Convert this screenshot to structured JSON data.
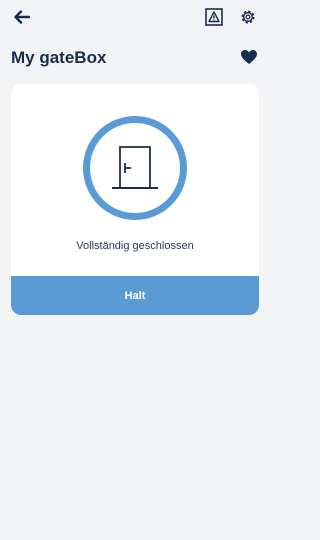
{
  "header": {
    "back_icon": "arrow-left-icon",
    "actions": [
      {
        "icon": "warning-triangle-icon"
      },
      {
        "icon": "gear-icon"
      }
    ]
  },
  "device": {
    "name": "My gateBox",
    "favorite_icon": "heart-icon",
    "favorite": true
  },
  "card": {
    "state_icon": "door-closed-icon",
    "status_text": "Vollständig geschlossen",
    "action_label": "Halt"
  },
  "colors": {
    "accent": "#5b9bd5",
    "text": "#1c2d4a",
    "background": "#f3f4f6",
    "card": "#ffffff"
  }
}
